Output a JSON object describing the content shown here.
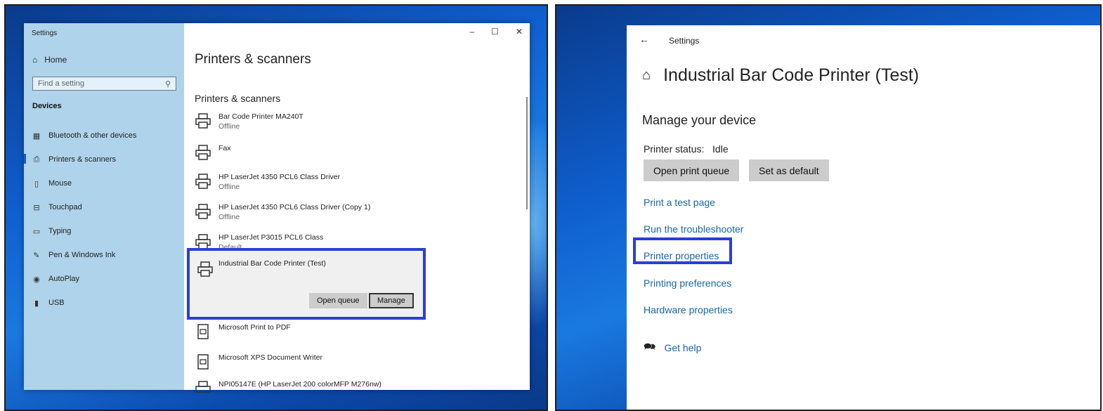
{
  "left": {
    "window_title": "Settings",
    "controls": [
      "–",
      "☐",
      "✕"
    ],
    "sidebar": {
      "home_label": "Home",
      "search_placeholder": "Find a setting",
      "section": "Devices",
      "items": [
        {
          "label": "Bluetooth & other devices",
          "icon": "bluetooth-icon"
        },
        {
          "label": "Printers & scanners",
          "icon": "printer-icon"
        },
        {
          "label": "Mouse",
          "icon": "mouse-icon"
        },
        {
          "label": "Touchpad",
          "icon": "touchpad-icon"
        },
        {
          "label": "Typing",
          "icon": "keyboard-icon"
        },
        {
          "label": "Pen & Windows Ink",
          "icon": "pen-icon"
        },
        {
          "label": "AutoPlay",
          "icon": "autoplay-icon"
        },
        {
          "label": "USB",
          "icon": "usb-icon"
        }
      ]
    },
    "page_title": "Printers & scanners",
    "section_title": "Printers & scanners",
    "printers": [
      {
        "name": "Bar Code Printer MA240T",
        "status": "Offline"
      },
      {
        "name": "Fax",
        "status": ""
      },
      {
        "name": "HP LaserJet 4350 PCL6 Class Driver",
        "status": "Offline"
      },
      {
        "name": "HP LaserJet 4350 PCL6 Class Driver (Copy 1)",
        "status": "Offline"
      },
      {
        "name": "HP LaserJet P3015 PCL6 Class",
        "status": "Default"
      }
    ],
    "selected_printer": {
      "name": "Industrial Bar Code Printer (Test)",
      "open_queue_label": "Open queue",
      "manage_label": "Manage"
    },
    "more_printers": [
      {
        "name": "Microsoft Print to PDF"
      },
      {
        "name": "Microsoft XPS Document Writer"
      },
      {
        "name": "NPI05147E (HP LaserJet 200 colorMFP M276nw)"
      }
    ]
  },
  "right": {
    "back_label": "←",
    "settings_label": "Settings",
    "title": "Industrial Bar Code Printer (Test)",
    "manage_heading": "Manage your device",
    "status_label": "Printer status:",
    "status_value": "Idle",
    "open_queue_label": "Open print queue",
    "set_default_label": "Set as default",
    "links": [
      "Print a test page",
      "Run the troubleshooter",
      "Printer properties",
      "Printing preferences",
      "Hardware properties"
    ],
    "help_label": "Get help"
  },
  "colors": {
    "sidebar_bg": "#aed3ea",
    "link": "#1767a6",
    "highlight": "#2a3fd6",
    "button_bg": "#cccccc"
  }
}
